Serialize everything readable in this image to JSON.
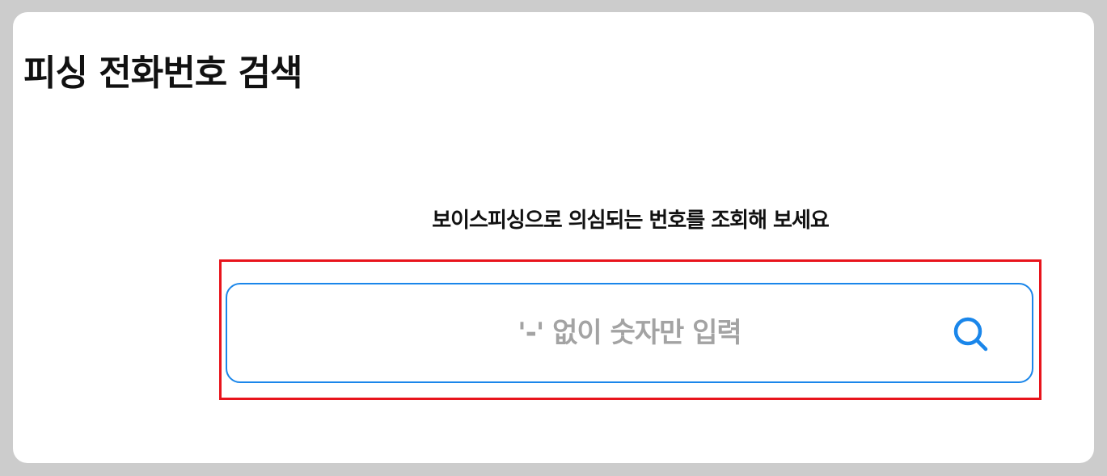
{
  "page": {
    "title": "피싱 전화번호 검색"
  },
  "search": {
    "prompt": "보이스피싱으로 의심되는 번호를 조회해 보세요",
    "placeholder": "'-' 없이 숫자만 입력",
    "value": "",
    "button_icon": "search-icon"
  },
  "colors": {
    "background": "#cccccc",
    "card": "#ffffff",
    "accent": "#1a86ea",
    "highlight": "#e8141c",
    "placeholder": "#a3a3a3"
  }
}
